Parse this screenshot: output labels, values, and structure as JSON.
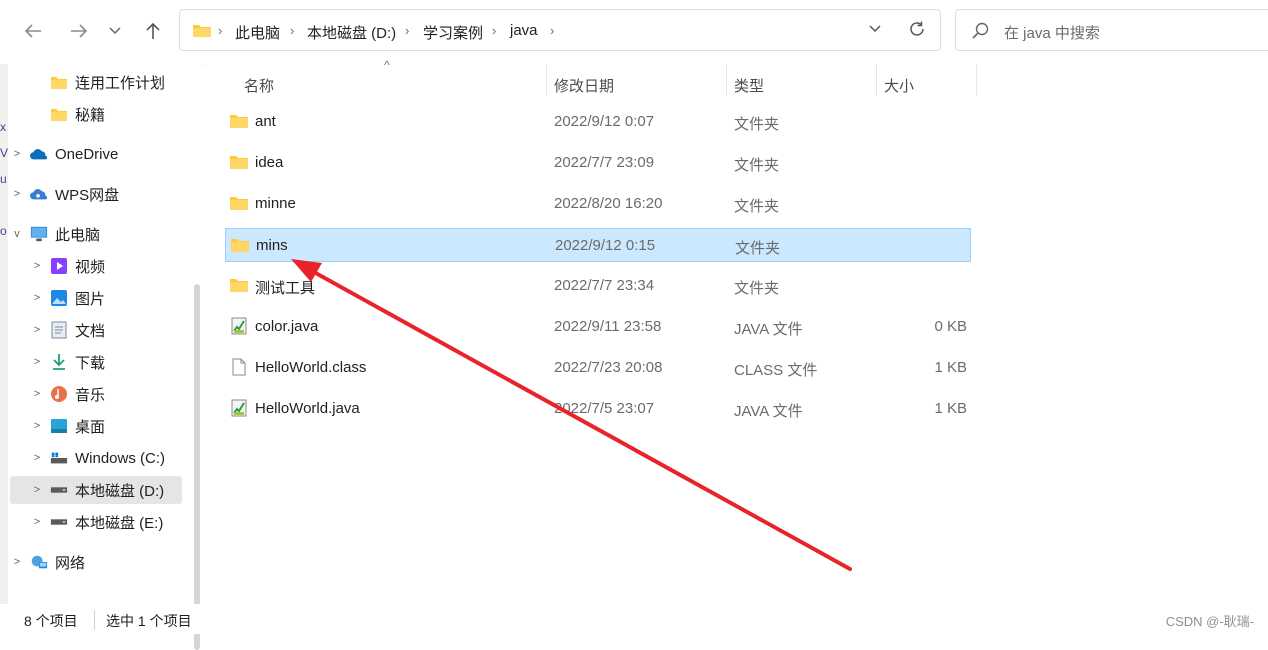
{
  "address": {
    "crumbs": [
      "此电脑",
      "本地磁盘 (D:)",
      "学习案例",
      "java"
    ]
  },
  "search": {
    "placeholder": "在 java 中搜索"
  },
  "sidebar": {
    "items": [
      {
        "label": "连用工作计划",
        "icon": "folder-icon"
      },
      {
        "label": "秘籍",
        "icon": "folder-icon"
      },
      {
        "label": "OneDrive",
        "icon": "onedrive-cloud-icon"
      },
      {
        "label": "WPS网盘",
        "icon": "wps-cloud-icon"
      },
      {
        "label": "此电脑",
        "icon": "computer-icon"
      },
      {
        "label": "视频",
        "icon": "video-icon"
      },
      {
        "label": "图片",
        "icon": "picture-icon"
      },
      {
        "label": "文档",
        "icon": "document-icon"
      },
      {
        "label": "下载",
        "icon": "download-icon"
      },
      {
        "label": "音乐",
        "icon": "music-icon"
      },
      {
        "label": "桌面",
        "icon": "desktop-icon"
      },
      {
        "label": "Windows (C:)",
        "icon": "windows-drive-icon"
      },
      {
        "label": "本地磁盘 (D:)",
        "icon": "drive-icon"
      },
      {
        "label": "本地磁盘 (E:)",
        "icon": "drive-icon"
      },
      {
        "label": "网络",
        "icon": "network-icon"
      }
    ]
  },
  "columns": {
    "name": "名称",
    "date": "修改日期",
    "type": "类型",
    "size": "大小"
  },
  "files": [
    {
      "name": "ant",
      "date": "2022/9/12 0:07",
      "type": "文件夹",
      "size": "",
      "icon": "folder-icon"
    },
    {
      "name": "idea",
      "date": "2022/7/7 23:09",
      "type": "文件夹",
      "size": "",
      "icon": "folder-icon"
    },
    {
      "name": "minne",
      "date": "2022/8/20 16:20",
      "type": "文件夹",
      "size": "",
      "icon": "folder-icon"
    },
    {
      "name": "mins",
      "date": "2022/9/12 0:15",
      "type": "文件夹",
      "size": "",
      "icon": "folder-icon"
    },
    {
      "name": "测试工具",
      "date": "2022/7/7 23:34",
      "type": "文件夹",
      "size": "",
      "icon": "folder-icon"
    },
    {
      "name": "color.java",
      "date": "2022/9/11 23:58",
      "type": "JAVA 文件",
      "size": "0 KB",
      "icon": "java-file-icon"
    },
    {
      "name": "HelloWorld.class",
      "date": "2022/7/23 20:08",
      "type": "CLASS 文件",
      "size": "1 KB",
      "icon": "blank-file-icon"
    },
    {
      "name": "HelloWorld.java",
      "date": "2022/7/5 23:07",
      "type": "JAVA 文件",
      "size": "1 KB",
      "icon": "java-file-icon"
    }
  ],
  "status": {
    "count": "8 个项目",
    "selected": "选中 1 个项目"
  },
  "watermark": "CSDN @-耿瑞-",
  "colors": {
    "selection": "#cce8ff",
    "selection_border": "#99d1ff",
    "annotation_arrow": "#e8232a",
    "folder": "#ffc83d"
  }
}
